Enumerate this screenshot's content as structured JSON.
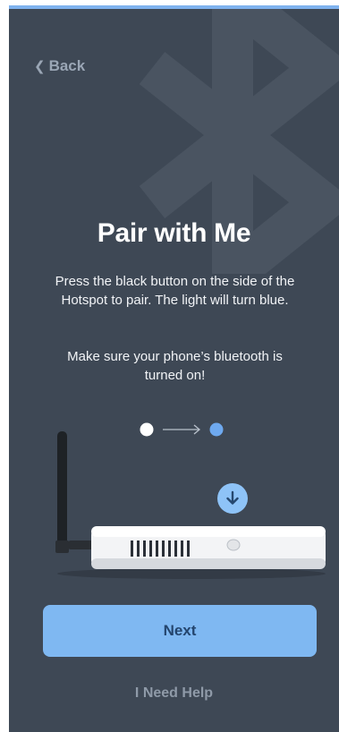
{
  "nav": {
    "back_label": "Back"
  },
  "header": {
    "title": "Pair with Me"
  },
  "instructions": {
    "paragraph1": "Press the black button on the side of the Hotspot to pair. The light will turn blue.",
    "paragraph2": "Make sure your phone’s bluetooth is turned on!"
  },
  "steps": {
    "current_step": 1,
    "total_steps": 2
  },
  "actions": {
    "next_label": "Next",
    "help_label": "I Need Help"
  },
  "colors": {
    "background": "#3e4855",
    "accent": "#7fb8f2",
    "step_inactive": "#ffffff",
    "step_active": "#6ea9ef"
  },
  "icons": {
    "back": "chevron-left-icon",
    "watermark": "bluetooth-icon",
    "badge": "arrow-down-icon"
  }
}
